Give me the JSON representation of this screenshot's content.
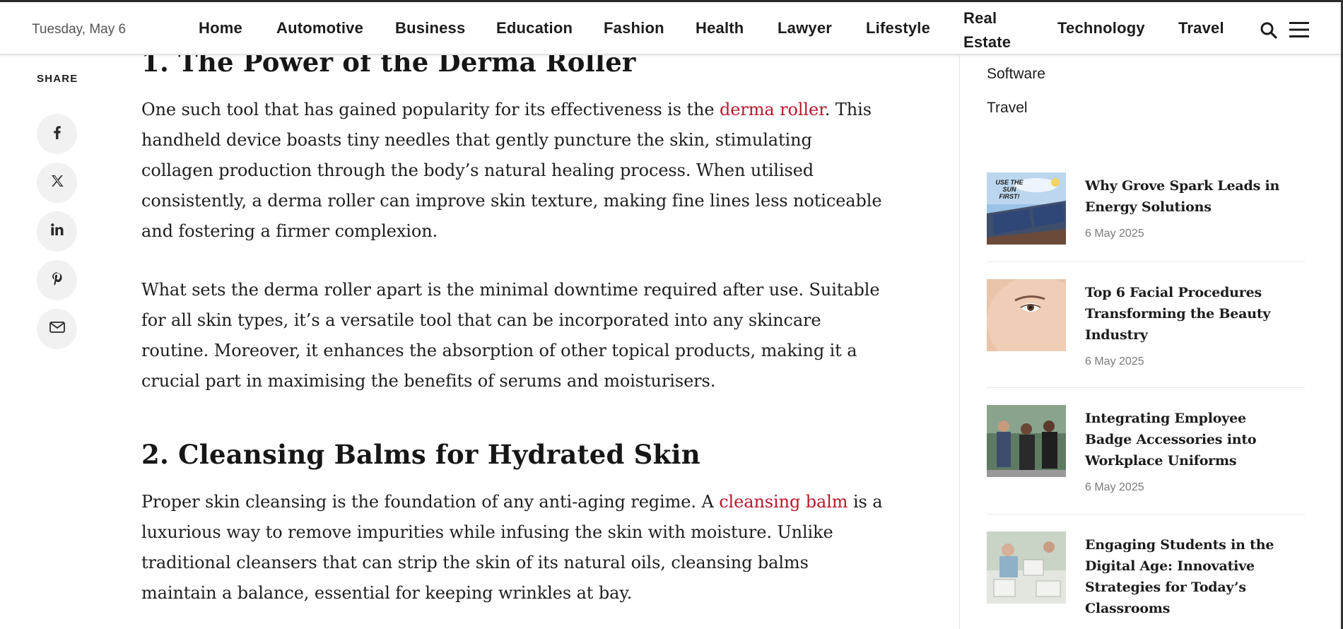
{
  "header": {
    "date": "Tuesday, May 6",
    "nav": [
      {
        "label": "Home"
      },
      {
        "label": "Automotive"
      },
      {
        "label": "Business"
      },
      {
        "label": "Education"
      },
      {
        "label": "Fashion"
      },
      {
        "label": "Health"
      },
      {
        "label": "Lawyer"
      },
      {
        "label": "Lifestyle"
      },
      {
        "label": "Real Estate"
      },
      {
        "label": "Technology"
      },
      {
        "label": "Travel"
      }
    ],
    "search_icon": "search-icon",
    "menu_icon": "hamburger-menu-icon"
  },
  "share": {
    "label": "SHARE",
    "buttons": [
      "facebook-icon",
      "x-twitter-icon",
      "linkedin-icon",
      "pinterest-icon",
      "email-icon"
    ]
  },
  "article": {
    "section1_heading": "1. The Power of the Derma Roller",
    "section1_p1_before": "One such tool that has gained popularity for its effectiveness is the ",
    "section1_p1_link": "derma roller",
    "section1_p1_after": ". This handheld device boasts tiny needles that gently puncture the skin, stimulating collagen production through the body’s natural healing process. When utilised consistently, a derma roller can improve skin texture, making fine lines less noticeable and fostering a firmer complexion.",
    "section1_p2": "What sets the derma roller apart is the minimal downtime required after use. Suitable for all skin types, it’s a versatile tool that can be incorporated into any skincare routine. Moreover, it enhances the absorption of other topical products, making it a crucial part in maximising the benefits of serums and moisturisers.",
    "section2_heading": "2. Cleansing Balms for Hydrated Skin",
    "section2_p1_before": "Proper skin cleansing is the foundation of any anti-aging regime. A ",
    "section2_p1_link": "cleansing balm",
    "section2_p1_after": " is a luxurious way to remove impurities while infusing the skin with moisture. Unlike traditional cleansers that can strip the skin of its natural oils, cleansing balms maintain a balance, essential for keeping wrinkles at bay."
  },
  "sidebar": {
    "categories": [
      "Software",
      "Travel"
    ],
    "posts": [
      {
        "title": "Why Grove Spark Leads in Energy Solutions",
        "date": "6 May 2025",
        "thumb_text": "USE THE SUN FIRST!"
      },
      {
        "title": "Top 6 Facial Procedures Transforming the Beauty Industry",
        "date": "6 May 2025"
      },
      {
        "title": "Integrating Employee Badge Accessories into Workplace Uniforms",
        "date": "6 May 2025"
      },
      {
        "title": "Engaging Students in the Digital Age: Innovative Strategies for Today’s Classrooms",
        "date": ""
      }
    ]
  },
  "colors": {
    "link": "#b8182c",
    "text": "#1e1e1e",
    "muted": "#7a7a7a"
  }
}
